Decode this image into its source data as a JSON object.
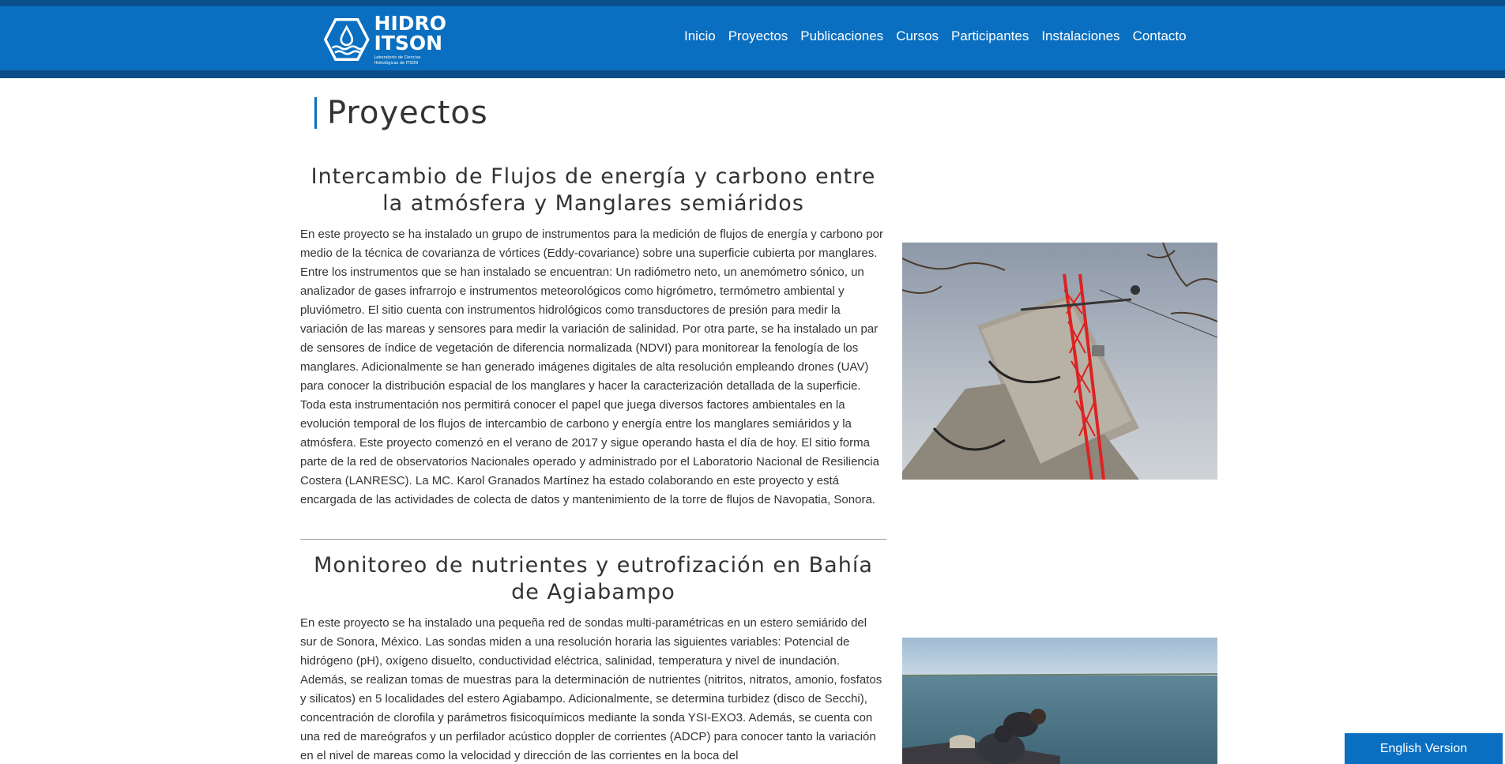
{
  "header": {
    "logo_line1": "HIDRO",
    "logo_line2": "ITSON",
    "logo_subtitle": "Laboratorio de Ciencias Hidrológicas de ITSON",
    "nav": [
      {
        "label": "Inicio"
      },
      {
        "label": "Proyectos"
      },
      {
        "label": "Publicaciones"
      },
      {
        "label": "Cursos"
      },
      {
        "label": "Participantes"
      },
      {
        "label": "Instalaciones"
      },
      {
        "label": "Contacto"
      }
    ]
  },
  "page": {
    "title": "Proyectos"
  },
  "projects": [
    {
      "title": "Intercambio de Flujos de energía y carbono entre la atmósfera y Manglares semiáridos",
      "body": "En este proyecto se ha instalado un grupo de instrumentos para la medición de flujos de energía y carbono por medio de la técnica de covarianza de vórtices (Eddy-covariance) sobre una superficie cubierta por manglares. Entre los instrumentos que se han instalado se encuentran: Un radiómetro neto, un anemómetro sónico, un analizador de gases infrarrojo e instrumentos meteorológicos como higrómetro, termómetro ambiental y pluviómetro. El sitio cuenta con instrumentos hidrológicos como transductores de presión para medir la variación de las mareas y sensores para medir la variación de salinidad. Por otra parte, se ha instalado un par de sensores de índice de vegetación de diferencia normalizada (NDVI) para monitorear la fenología de los manglares. Adicionalmente se han generado imágenes digitales de alta resolución empleando drones (UAV) para conocer la distribución espacial de los manglares y hacer la caracterización detallada de la superficie. Toda esta instrumentación nos permitirá conocer el papel que juega diversos factores ambientales en la evolución temporal de los flujos de intercambio de carbono y energía entre los manglares semiáridos y la atmósfera. Este proyecto comenzó en el verano de 2017 y sigue operando hasta el día de hoy. El sitio forma parte de la red de observatorios Nacionales operado y administrado por el Laboratorio Nacional de Resiliencia Costera (LANRESC). La MC. Karol Granados Martínez ha estado colaborando en este proyecto y está encargada de las actividades de colecta de datos y mantenimiento de la torre de flujos de Navopatia, Sonora."
    },
    {
      "title": "Monitoreo de nutrientes y eutrofización en Bahía de Agiabampo",
      "body": "En este proyecto se ha instalado una pequeña red de sondas multi-paramétricas en un estero semiárido del sur de Sonora, México. Las sondas miden a una resolución horaria las siguientes variables: Potencial de hidrógeno (pH), oxígeno disuelto, conductividad eléctrica, salinidad, temperatura y nivel de inundación. Además, se realizan tomas de muestras para la determinación de nutrientes (nitritos, nitratos, amonio, fosfatos y silicatos) en 5 localidades del estero Agiabampo. Adicionalmente, se determina turbidez (disco de Secchi), concentración de clorofila y parámetros fisicoquímicos mediante la sonda YSI-EXO3. Además, se cuenta con una red de mareógrafos y un perfilador acústico doppler de corrientes (ADCP) para conocer tanto la variación en el nivel de mareas como la velocidad y dirección de las corrientes en la boca del"
    }
  ],
  "footer": {
    "english_button": "English Version"
  },
  "colors": {
    "header_blue": "#0a6fc0",
    "header_dark": "#0b4f8a"
  }
}
